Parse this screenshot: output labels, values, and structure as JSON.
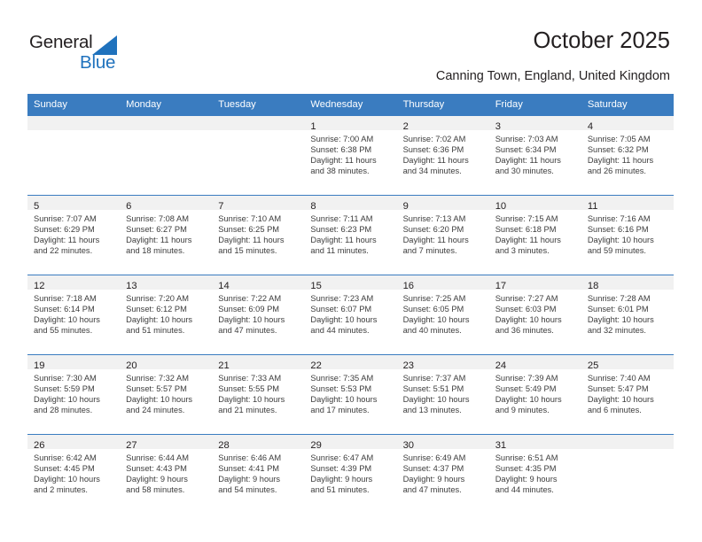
{
  "brand": {
    "name_part1": "General",
    "name_part2": "Blue",
    "triangle_color": "#1f72bd",
    "text_color": "#231f20"
  },
  "header": {
    "title": "October 2025",
    "location": "Canning Town, England, United Kingdom"
  },
  "theme": {
    "header_blue": "#3a7cc0",
    "daynum_band": "#f1f1f1",
    "body_text": "#3c3c3c"
  },
  "calendar": {
    "weekday_headers": [
      "Sunday",
      "Monday",
      "Tuesday",
      "Wednesday",
      "Thursday",
      "Friday",
      "Saturday"
    ],
    "weeks": [
      [
        {
          "day": "",
          "lines": []
        },
        {
          "day": "",
          "lines": []
        },
        {
          "day": "",
          "lines": []
        },
        {
          "day": "1",
          "lines": [
            "Sunrise: 7:00 AM",
            "Sunset: 6:38 PM",
            "Daylight: 11 hours",
            "and 38 minutes."
          ]
        },
        {
          "day": "2",
          "lines": [
            "Sunrise: 7:02 AM",
            "Sunset: 6:36 PM",
            "Daylight: 11 hours",
            "and 34 minutes."
          ]
        },
        {
          "day": "3",
          "lines": [
            "Sunrise: 7:03 AM",
            "Sunset: 6:34 PM",
            "Daylight: 11 hours",
            "and 30 minutes."
          ]
        },
        {
          "day": "4",
          "lines": [
            "Sunrise: 7:05 AM",
            "Sunset: 6:32 PM",
            "Daylight: 11 hours",
            "and 26 minutes."
          ]
        }
      ],
      [
        {
          "day": "5",
          "lines": [
            "Sunrise: 7:07 AM",
            "Sunset: 6:29 PM",
            "Daylight: 11 hours",
            "and 22 minutes."
          ]
        },
        {
          "day": "6",
          "lines": [
            "Sunrise: 7:08 AM",
            "Sunset: 6:27 PM",
            "Daylight: 11 hours",
            "and 18 minutes."
          ]
        },
        {
          "day": "7",
          "lines": [
            "Sunrise: 7:10 AM",
            "Sunset: 6:25 PM",
            "Daylight: 11 hours",
            "and 15 minutes."
          ]
        },
        {
          "day": "8",
          "lines": [
            "Sunrise: 7:11 AM",
            "Sunset: 6:23 PM",
            "Daylight: 11 hours",
            "and 11 minutes."
          ]
        },
        {
          "day": "9",
          "lines": [
            "Sunrise: 7:13 AM",
            "Sunset: 6:20 PM",
            "Daylight: 11 hours",
            "and 7 minutes."
          ]
        },
        {
          "day": "10",
          "lines": [
            "Sunrise: 7:15 AM",
            "Sunset: 6:18 PM",
            "Daylight: 11 hours",
            "and 3 minutes."
          ]
        },
        {
          "day": "11",
          "lines": [
            "Sunrise: 7:16 AM",
            "Sunset: 6:16 PM",
            "Daylight: 10 hours",
            "and 59 minutes."
          ]
        }
      ],
      [
        {
          "day": "12",
          "lines": [
            "Sunrise: 7:18 AM",
            "Sunset: 6:14 PM",
            "Daylight: 10 hours",
            "and 55 minutes."
          ]
        },
        {
          "day": "13",
          "lines": [
            "Sunrise: 7:20 AM",
            "Sunset: 6:12 PM",
            "Daylight: 10 hours",
            "and 51 minutes."
          ]
        },
        {
          "day": "14",
          "lines": [
            "Sunrise: 7:22 AM",
            "Sunset: 6:09 PM",
            "Daylight: 10 hours",
            "and 47 minutes."
          ]
        },
        {
          "day": "15",
          "lines": [
            "Sunrise: 7:23 AM",
            "Sunset: 6:07 PM",
            "Daylight: 10 hours",
            "and 44 minutes."
          ]
        },
        {
          "day": "16",
          "lines": [
            "Sunrise: 7:25 AM",
            "Sunset: 6:05 PM",
            "Daylight: 10 hours",
            "and 40 minutes."
          ]
        },
        {
          "day": "17",
          "lines": [
            "Sunrise: 7:27 AM",
            "Sunset: 6:03 PM",
            "Daylight: 10 hours",
            "and 36 minutes."
          ]
        },
        {
          "day": "18",
          "lines": [
            "Sunrise: 7:28 AM",
            "Sunset: 6:01 PM",
            "Daylight: 10 hours",
            "and 32 minutes."
          ]
        }
      ],
      [
        {
          "day": "19",
          "lines": [
            "Sunrise: 7:30 AM",
            "Sunset: 5:59 PM",
            "Daylight: 10 hours",
            "and 28 minutes."
          ]
        },
        {
          "day": "20",
          "lines": [
            "Sunrise: 7:32 AM",
            "Sunset: 5:57 PM",
            "Daylight: 10 hours",
            "and 24 minutes."
          ]
        },
        {
          "day": "21",
          "lines": [
            "Sunrise: 7:33 AM",
            "Sunset: 5:55 PM",
            "Daylight: 10 hours",
            "and 21 minutes."
          ]
        },
        {
          "day": "22",
          "lines": [
            "Sunrise: 7:35 AM",
            "Sunset: 5:53 PM",
            "Daylight: 10 hours",
            "and 17 minutes."
          ]
        },
        {
          "day": "23",
          "lines": [
            "Sunrise: 7:37 AM",
            "Sunset: 5:51 PM",
            "Daylight: 10 hours",
            "and 13 minutes."
          ]
        },
        {
          "day": "24",
          "lines": [
            "Sunrise: 7:39 AM",
            "Sunset: 5:49 PM",
            "Daylight: 10 hours",
            "and 9 minutes."
          ]
        },
        {
          "day": "25",
          "lines": [
            "Sunrise: 7:40 AM",
            "Sunset: 5:47 PM",
            "Daylight: 10 hours",
            "and 6 minutes."
          ]
        }
      ],
      [
        {
          "day": "26",
          "lines": [
            "Sunrise: 6:42 AM",
            "Sunset: 4:45 PM",
            "Daylight: 10 hours",
            "and 2 minutes."
          ]
        },
        {
          "day": "27",
          "lines": [
            "Sunrise: 6:44 AM",
            "Sunset: 4:43 PM",
            "Daylight: 9 hours",
            "and 58 minutes."
          ]
        },
        {
          "day": "28",
          "lines": [
            "Sunrise: 6:46 AM",
            "Sunset: 4:41 PM",
            "Daylight: 9 hours",
            "and 54 minutes."
          ]
        },
        {
          "day": "29",
          "lines": [
            "Sunrise: 6:47 AM",
            "Sunset: 4:39 PM",
            "Daylight: 9 hours",
            "and 51 minutes."
          ]
        },
        {
          "day": "30",
          "lines": [
            "Sunrise: 6:49 AM",
            "Sunset: 4:37 PM",
            "Daylight: 9 hours",
            "and 47 minutes."
          ]
        },
        {
          "day": "31",
          "lines": [
            "Sunrise: 6:51 AM",
            "Sunset: 4:35 PM",
            "Daylight: 9 hours",
            "and 44 minutes."
          ]
        },
        {
          "day": "",
          "lines": []
        }
      ]
    ]
  }
}
